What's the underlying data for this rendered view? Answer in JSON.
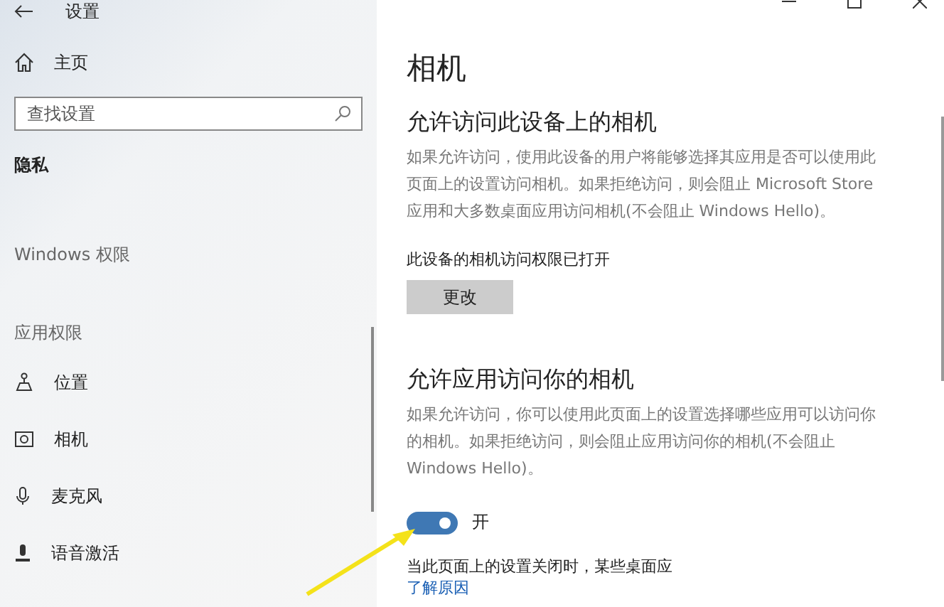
{
  "window": {
    "title": "设置"
  },
  "sidebar": {
    "home": "主页",
    "search": {
      "placeholder": "查找设置"
    },
    "section": "隐私",
    "groups": [
      {
        "label": "Windows 权限"
      },
      {
        "label": "应用权限",
        "items": [
          {
            "kind": "location",
            "label": "位置"
          },
          {
            "kind": "camera",
            "label": "相机"
          },
          {
            "kind": "microphone",
            "label": "麦克风"
          },
          {
            "kind": "voice",
            "label": "语音激活"
          }
        ]
      }
    ]
  },
  "page": {
    "title": "相机",
    "device_section": {
      "heading": "允许访问此设备上的相机",
      "description": "如果允许访问，使用此设备的用户将能够选择其应用是否可以使用此页面上的设置访问相机。如果拒绝访问，则会阻止 Microsoft Store 应用和大多数桌面应用访问相机(不会阻止 Windows Hello)。",
      "status": "此设备的相机访问权限已打开",
      "button": "更改"
    },
    "apps_section": {
      "heading": "允许应用访问你的相机",
      "description": "如果允许访问，你可以使用此页面上的设置选择哪些应用可以访问你的相机。如果拒绝访问，则会阻止应用访问你的相机(不会阻止 Windows Hello)。",
      "toggle": {
        "on": true,
        "label": "开"
      },
      "note": "当此页面上的设置关闭时，某些桌面应",
      "link": "了解原因"
    }
  }
}
